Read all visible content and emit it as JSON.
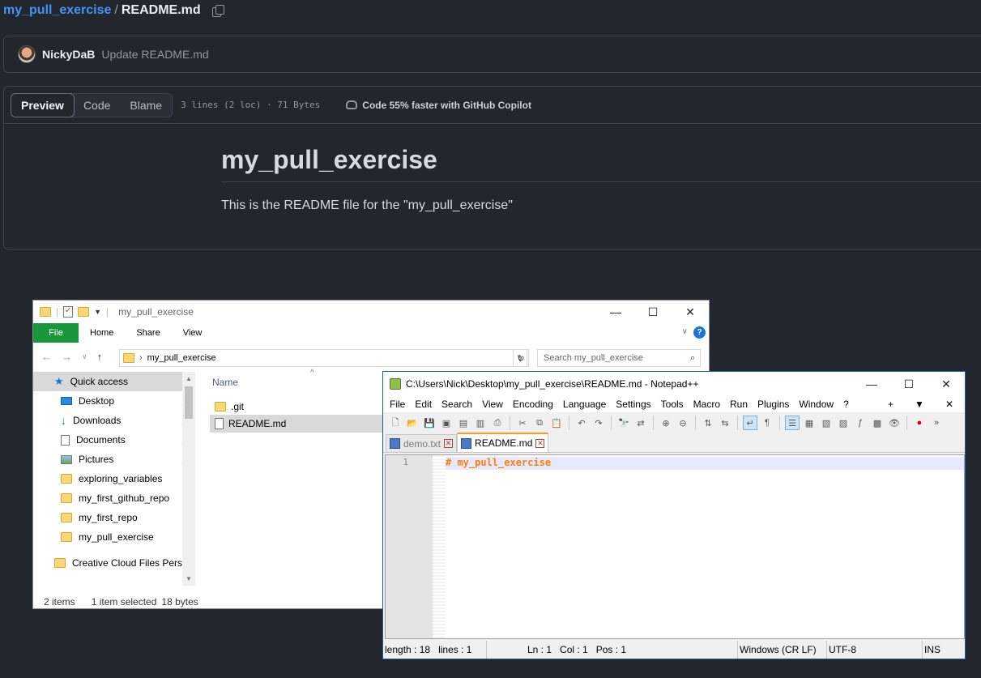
{
  "github": {
    "repo": "my_pull_exercise",
    "separator": "/",
    "file": "README.md",
    "commit": {
      "author": "NickyDaB",
      "message": "Update README.md"
    },
    "tabs": [
      "Preview",
      "Code",
      "Blame"
    ],
    "meta": "3 lines (2 loc) · 71 Bytes",
    "copilot": "Code 55% faster with GitHub Copilot",
    "readme": {
      "heading": "my_pull_exercise",
      "body": "This is the README file for the \"my_pull_exercise\""
    }
  },
  "explorer": {
    "title": "my_pull_exercise",
    "ribbon": {
      "file": "File",
      "home": "Home",
      "share": "Share",
      "view": "View",
      "help": "?"
    },
    "address": "my_pull_exercise",
    "search_placeholder": "Search my_pull_exercise",
    "nav": {
      "quick_access": "Quick access",
      "items": [
        "Desktop",
        "Downloads",
        "Documents",
        "Pictures",
        "exploring_variables",
        "my_first_github_repo",
        "my_first_repo",
        "my_pull_exercise"
      ],
      "cloud": "Creative Cloud Files Persor"
    },
    "column_name": "Name",
    "files": [
      ".git",
      "README.md"
    ],
    "status": {
      "count": "2 items",
      "selected": "1 item selected",
      "size": "18 bytes"
    },
    "window_buttons": {
      "min": "—",
      "max": "☐",
      "close": "✕"
    }
  },
  "notepad": {
    "title": "C:\\Users\\Nick\\Desktop\\my_pull_exercise\\README.md - Notepad++",
    "menu": [
      "File",
      "Edit",
      "Search",
      "View",
      "Encoding",
      "Language",
      "Settings",
      "Tools",
      "Macro",
      "Run",
      "Plugins",
      "Window",
      "?"
    ],
    "menu_right": [
      "+",
      "▼",
      "✕"
    ],
    "tabs": [
      "demo.txt",
      "README.md"
    ],
    "line_number": "1",
    "code_line": "# my_pull_exercise",
    "status": {
      "length": "length : 18",
      "lines": "lines : 1",
      "ln": "Ln : 1",
      "col": "Col : 1",
      "pos": "Pos : 1",
      "eol": "Windows (CR LF)",
      "encoding": "UTF-8",
      "mode": "INS"
    },
    "window_buttons": {
      "min": "—",
      "max": "☐",
      "close": "✕"
    }
  }
}
